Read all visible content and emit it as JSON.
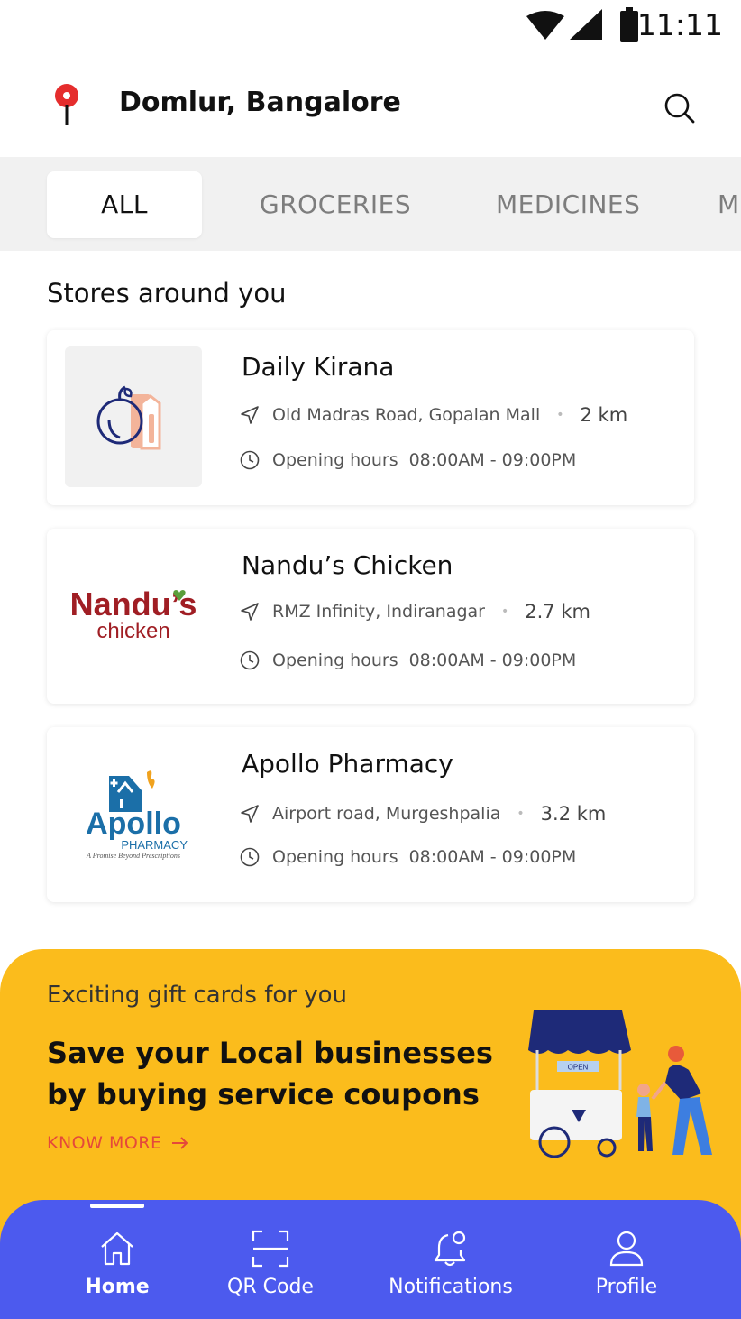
{
  "status_bar": {
    "time": "11:11"
  },
  "header": {
    "location": "Domlur, Bangalore"
  },
  "tabs": [
    {
      "label": "ALL",
      "active": true
    },
    {
      "label": "GROCERIES",
      "active": false
    },
    {
      "label": "MEDICINES",
      "active": false
    },
    {
      "label": "M",
      "active": false
    }
  ],
  "section_title": "Stores around you",
  "stores": [
    {
      "name": "Daily Kirana",
      "address": "Old Madras Road, Gopalan Mall",
      "distance": "2 km",
      "hours_label": "Opening hours",
      "hours": "08:00AM - 09:00PM",
      "logo": "grocery-icon"
    },
    {
      "name": "Nandu’s Chicken",
      "address": "RMZ Infinity, Indiranagar",
      "distance": "2.7 km",
      "hours_label": "Opening hours",
      "hours": "08:00AM - 09:00PM",
      "logo": {
        "line1": "Nandu’s",
        "line2": "chicken",
        "color": "#a01e24"
      }
    },
    {
      "name": "Apollo Pharmacy",
      "address": "Airport road, Murgeshpalia",
      "distance": "3.2 km",
      "hours_label": "Opening hours",
      "hours": "08:00AM - 09:00PM",
      "logo": {
        "line1": "Apollo",
        "line2": "PHARMACY",
        "tagline": "A Promise Beyond Prescriptions",
        "color": "#1b6fa8"
      }
    }
  ],
  "promo": {
    "subtitle": "Exciting gift cards for you",
    "headline": "Save your Local businesses by buying service coupons",
    "cta": "KNOW MORE",
    "stall_sign": "OPEN",
    "background": "#fbbc1c",
    "cta_color": "#e5493a"
  },
  "bottom_nav": {
    "background": "#4c5aee",
    "items": [
      {
        "label": "Home",
        "icon": "home-icon",
        "active": true
      },
      {
        "label": "QR Code",
        "icon": "qr-scan-icon",
        "active": false
      },
      {
        "label": "Notifications",
        "icon": "bell-icon",
        "active": false
      },
      {
        "label": "Profile",
        "icon": "user-icon",
        "active": false
      }
    ]
  }
}
